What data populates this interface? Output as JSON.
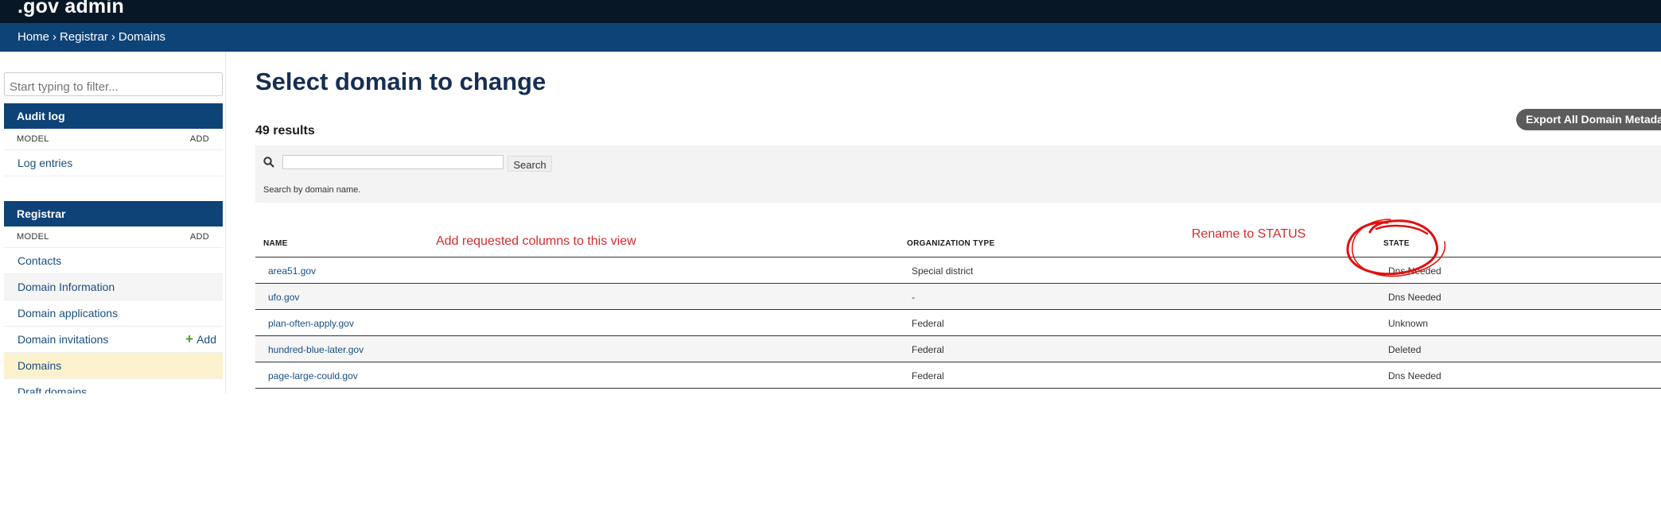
{
  "app": {
    "brand": ".gov admin"
  },
  "breadcrumbs": [
    "Home",
    "Registrar",
    "Domains"
  ],
  "breadcrumb_separator": "›",
  "sidebar": {
    "filter_placeholder": "Start typing to filter...",
    "modules": [
      {
        "title": "Audit log",
        "model_label": "MODEL",
        "add_label": "ADD",
        "items": [
          {
            "label": "Log entries"
          }
        ]
      },
      {
        "title": "Registrar",
        "model_label": "MODEL",
        "add_label": "ADD",
        "items": [
          {
            "label": "Contacts"
          },
          {
            "label": "Domain Information"
          },
          {
            "label": "Domain applications"
          },
          {
            "label": "Domain invitations",
            "action": "Add"
          },
          {
            "label": "Domains",
            "selected": true
          },
          {
            "label": "Draft domains"
          }
        ]
      }
    ]
  },
  "main": {
    "title": "Select domain to change",
    "results": "49 results",
    "export_label": "Export All Domain Metadata",
    "search": {
      "button": "Search",
      "help": "Search by domain name.",
      "value": ""
    },
    "table": {
      "columns": [
        "NAME",
        "ORGANIZATION TYPE",
        "STATE"
      ],
      "rows": [
        {
          "name": "area51.gov",
          "org_type": "Special district",
          "state": "Dns Needed"
        },
        {
          "name": "ufo.gov",
          "org_type": "-",
          "state": "Dns Needed"
        },
        {
          "name": "plan-often-apply.gov",
          "org_type": "Federal",
          "state": "Unknown"
        },
        {
          "name": "hundred-blue-later.gov",
          "org_type": "Federal",
          "state": "Deleted"
        },
        {
          "name": "page-large-could.gov",
          "org_type": "Federal",
          "state": "Dns Needed"
        }
      ]
    }
  },
  "annotations": {
    "columns_note": "Add requested columns to this view",
    "rename_note": "Rename to STATUS",
    "color": "#d52c2c"
  },
  "colors": {
    "topbar": "#071726",
    "breadcrumb_bar": "#0e4377",
    "module_header": "#0e4377",
    "link": "#1a4e80",
    "selected_row": "#fbf2cd",
    "title": "#162e51"
  },
  "icons": {
    "search": "search-icon",
    "add": "plus-icon"
  }
}
